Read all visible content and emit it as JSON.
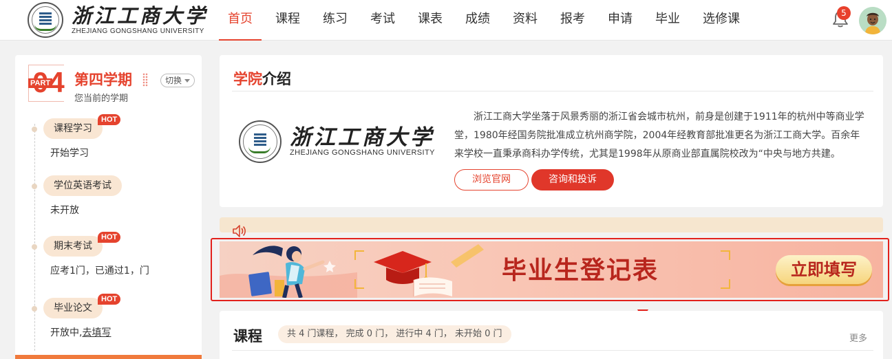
{
  "header": {
    "logo_cn": "浙江工商大学",
    "logo_en": "ZHEJIANG GONGSHANG UNIVERSITY",
    "nav": [
      {
        "label": "首页",
        "active": true
      },
      {
        "label": "课程"
      },
      {
        "label": "练习"
      },
      {
        "label": "考试"
      },
      {
        "label": "课表"
      },
      {
        "label": "成绩"
      },
      {
        "label": "资料"
      },
      {
        "label": "报考"
      },
      {
        "label": "申请"
      },
      {
        "label": "毕业"
      },
      {
        "label": "选修课"
      }
    ],
    "notification_count": "5",
    "icons": {
      "bell": "bell-icon",
      "avatar": "user-avatar"
    }
  },
  "sidebar": {
    "part_label": "PART",
    "semester_number": "04",
    "semester_title": "第四学期",
    "semester_subtitle": "您当前的学期",
    "switch_label": "切换",
    "steps": [
      {
        "label": "课程学习",
        "hot": "HOT",
        "status": "开始学习"
      },
      {
        "label": "学位英语考试",
        "hot": "",
        "status": "未开放"
      },
      {
        "label": "期末考试",
        "hot": "HOT",
        "status": "应考1门，已通过1，门"
      },
      {
        "label": "毕业论文",
        "hot": "HOT",
        "status_prefix": "开放中,",
        "status_link": "去填写"
      }
    ]
  },
  "intro": {
    "title_highlight": "学院",
    "title_rest": "介绍",
    "logo_cn": "浙江工商大学",
    "logo_en": "ZHEJIANG GONGSHANG UNIVERSITY",
    "text": "浙江工商大学坐落于风景秀丽的浙江省会城市杭州，前身是创建于1911年的杭州中等商业学堂，1980年经国务院批准成立杭州商学院，2004年经教育部批准更名为浙江工商大学。百余年来学校一直秉承商科办学传统，尤其是1998年从原商业部直属院校改为“中央与地方共建。",
    "btn_site": "浏览官网",
    "btn_consult": "咨询和投诉"
  },
  "notice": {
    "icon": "speaker-icon"
  },
  "banner": {
    "title": "毕业生登记表",
    "cta": "立即填写",
    "colors": {
      "highlight": "#e2211c",
      "title": "#b8261d"
    }
  },
  "courses": {
    "title": "课程",
    "stats": "共 4 门课程，  完成 0 门，  进行中 4 门，  未开始 0 门",
    "more": "更多"
  },
  "colors": {
    "accent": "#e5432e"
  }
}
